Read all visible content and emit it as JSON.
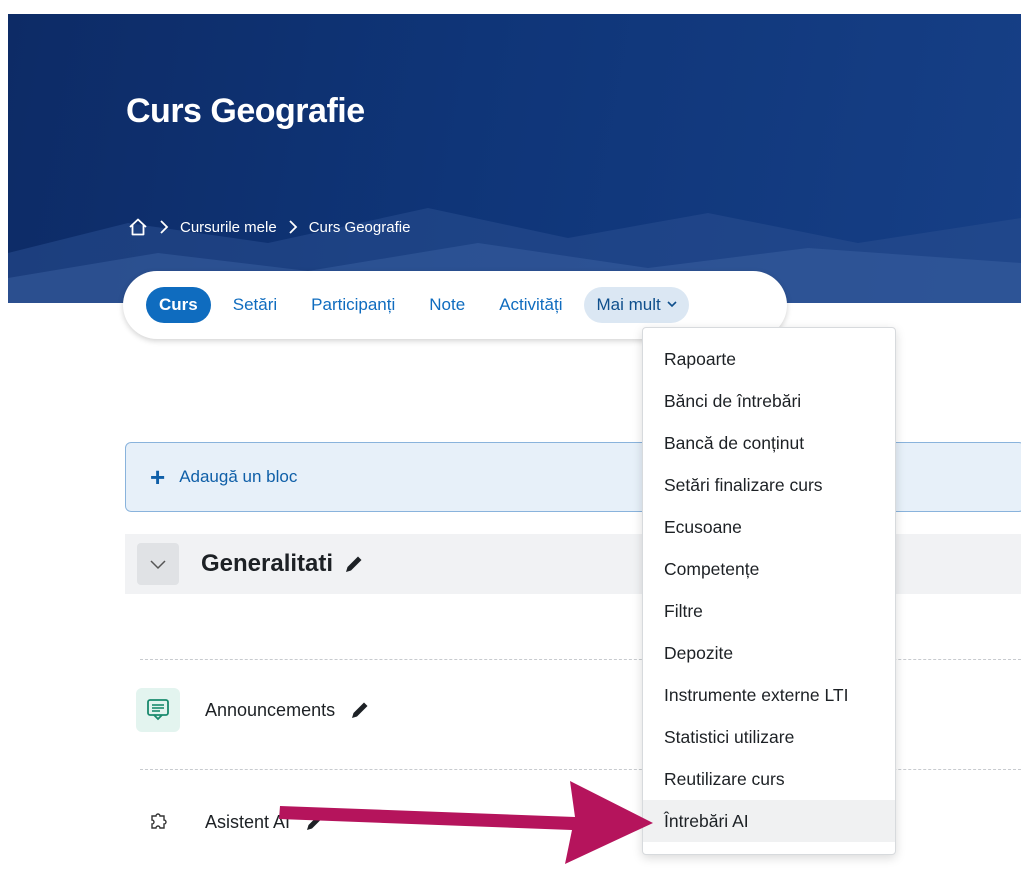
{
  "header": {
    "course_title": "Curs Geografie",
    "breadcrumb": {
      "home_icon": "home-icon",
      "items": [
        "Cursurile mele",
        "Curs Geografie"
      ]
    }
  },
  "secondary_nav": {
    "tabs": [
      "Curs",
      "Setări",
      "Participanți",
      "Note",
      "Activități"
    ],
    "more_label": "Mai mult",
    "active_tab": "Curs"
  },
  "more_menu": {
    "items": [
      "Rapoarte",
      "Bănci de întrebări",
      "Bancă de conținut",
      "Setări finalizare curs",
      "Ecusoane",
      "Competențe",
      "Filtre",
      "Depozite",
      "Instrumente externe LTI",
      "Statistici utilizare",
      "Reutilizare curs",
      "Întrebări AI"
    ],
    "highlighted_item": "Întrebări AI"
  },
  "add_block": {
    "label": "Adaugă un bloc"
  },
  "section": {
    "title": "Generalitati"
  },
  "activities": [
    {
      "name": "Announcements",
      "icon": "forum-icon"
    },
    {
      "name": "Asistent AI",
      "icon": "puzzle-icon"
    }
  ],
  "colors": {
    "header_bg": "#0f3578",
    "brand_blue": "#0f6cbf",
    "annotation_arrow": "#b5145c"
  }
}
